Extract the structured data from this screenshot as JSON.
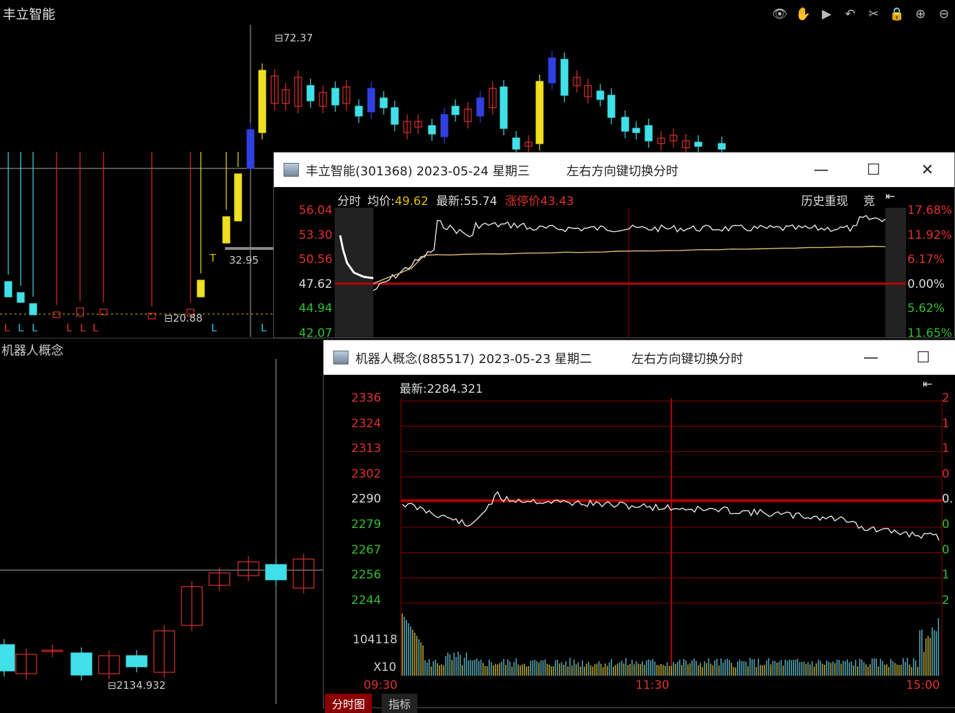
{
  "kline_top": {
    "stock_name": "丰立智能",
    "price_high_label": "72.37",
    "price_mid_label": "32.95",
    "price_low_label": "20.88",
    "mark_t": "T",
    "mark_l": "L"
  },
  "toolbar": {
    "icons": [
      "eye-icon",
      "hand-icon",
      "play-icon",
      "undo-icon",
      "scissors-icon",
      "lock-icon",
      "zoom-in-icon",
      "more-icon"
    ]
  },
  "kline_bottom": {
    "section_name": "机器人概念",
    "price_low_label": "2134.932"
  },
  "win1": {
    "title": "丰立智能(301368) 2023-05-24 星期三",
    "hint": "左右方向键切换分时",
    "header": {
      "label_fenshi": "分时",
      "avg_label": "均价:",
      "avg_value": "49.62",
      "last_label": "最新:",
      "last_value": "55.74",
      "limit_label": "涨停价",
      "limit_value": "43.43",
      "replay_button": "历史重现",
      "bid_button": "竞"
    },
    "y_left": [
      "56.04",
      "53.30",
      "50.56",
      "47.62",
      "44.94",
      "42.07"
    ],
    "y_right": [
      "17.68%",
      "11.92%",
      "6.17%",
      "0.00%",
      "5.62%",
      "11.65%"
    ]
  },
  "win2": {
    "title": "机器人概念(885517) 2023-05-23 星期二",
    "hint": "左右方向键切换分时",
    "header": {
      "last_label": "最新:",
      "last_value": "2284.321"
    },
    "y_left": [
      "2336",
      "2324",
      "2313",
      "2302",
      "2290",
      "2279",
      "2267",
      "2256",
      "2244"
    ],
    "y_right": [
      "2",
      "1",
      "1",
      "0",
      "0.",
      "0",
      "0",
      "1",
      "2"
    ],
    "vol_label": "104118",
    "vol_unit": "X10",
    "x_labels": [
      "09:30",
      "11:30",
      "15:00"
    ],
    "tabs": [
      "分时图",
      "指标"
    ]
  },
  "colors": {
    "up": "#e03030",
    "down": "#30c030",
    "yellow": "#f0e020",
    "cyan": "#40e0e8",
    "blue": "#3040e0",
    "grid_red": "#8a0000"
  }
}
